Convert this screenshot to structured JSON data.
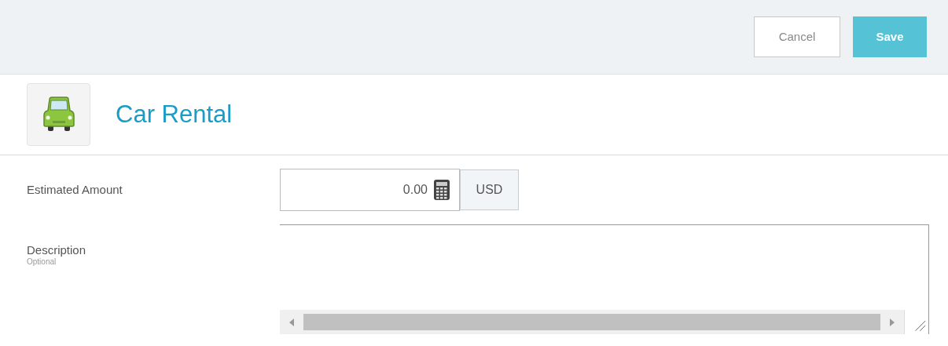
{
  "header": {
    "buttons": [
      {
        "label": "Cancel",
        "kind": "secondary"
      },
      {
        "label": "Save",
        "kind": "primary"
      }
    ]
  },
  "title": "Car Rental",
  "fields": [
    {
      "kind": "amount",
      "label": "Estimated Amount",
      "value": "0.00",
      "currency": "USD"
    },
    {
      "kind": "textarea",
      "label": "Description",
      "hint": "Optional"
    }
  ]
}
